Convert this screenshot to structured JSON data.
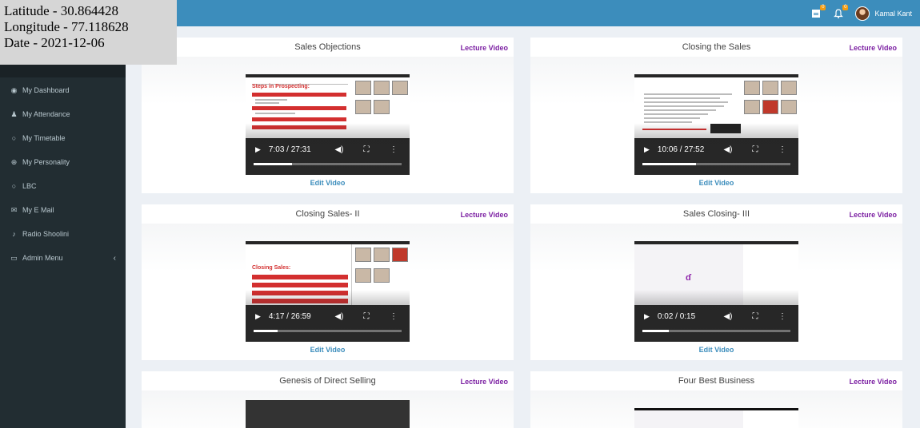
{
  "geo_overlay": {
    "latitude": "Latitude - 30.864428",
    "longitude": "Longitude - 77.118628",
    "date": "Date - 2021-12-06"
  },
  "topbar": {
    "tasks_badge": "0",
    "notifications_badge": "0",
    "user_name": "Kamal Kant",
    "icons": [
      "tasks-icon",
      "bell-icon",
      "avatar"
    ]
  },
  "sidebar": {
    "items": [
      {
        "label": "My Dashboard",
        "icon": "dashboard-icon",
        "glyph": "◉"
      },
      {
        "label": "My Attendance",
        "icon": "user-icon",
        "glyph": "♟"
      },
      {
        "label": "My Timetable",
        "icon": "circle-icon",
        "glyph": "○"
      },
      {
        "label": "My Personality",
        "icon": "globe-icon",
        "glyph": "⊕"
      },
      {
        "label": "LBC",
        "icon": "circle-icon",
        "glyph": "○"
      },
      {
        "label": "My E Mail",
        "icon": "envelope-icon",
        "glyph": "✉"
      },
      {
        "label": "Radio Shoolini",
        "icon": "microphone-icon",
        "glyph": "♪"
      },
      {
        "label": "Admin Menu",
        "icon": "laptop-icon",
        "glyph": "▭",
        "caret": "‹"
      }
    ]
  },
  "cards": [
    {
      "title": "Sales Objections",
      "link": "Lecture Video",
      "time": "7:03 / 27:31",
      "progress": 0.26,
      "edit": "Edit Video",
      "slide_heading": "Steps in Prospecting:"
    },
    {
      "title": "Closing the Sales",
      "link": "Lecture Video",
      "time": "10:06 / 27:52",
      "progress": 0.36,
      "edit": "Edit Video"
    },
    {
      "title": "Closing Sales- II",
      "link": "Lecture Video",
      "time": "4:17 / 26:59",
      "progress": 0.16,
      "edit": "Edit Video",
      "slide_heading": "Closing Sales:"
    },
    {
      "title": "Sales Closing- III",
      "link": "Lecture Video",
      "time": "0:02 / 0:15",
      "progress": 0.18,
      "edit": "Edit Video"
    },
    {
      "title": "Genesis of Direct Selling",
      "link": "Lecture Video"
    },
    {
      "title": "Four Best Business",
      "link": "Lecture Video"
    }
  ],
  "colors": {
    "header": "#3c8dbc",
    "sidebar": "#222d32",
    "lecture_link": "#7b1fa2",
    "edit_link": "#3c8dbc",
    "slide_red": "#d32f2f"
  }
}
